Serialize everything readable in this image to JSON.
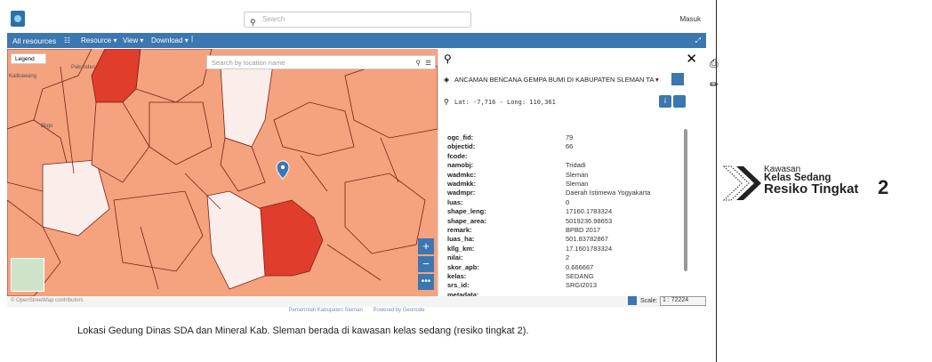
{
  "topbar": {
    "search_placeholder": "Search",
    "login": "Masuk"
  },
  "navbar": {
    "all_resources": "All resources",
    "resource": "Resource ▾",
    "view": "View ▾",
    "download": "Download ▾"
  },
  "map": {
    "legend": "Legend",
    "location_placeholder": "Search by location name",
    "labels": {
      "pakunden": "Pakunden",
      "kalibawang": "Kalibawang",
      "bligo": "Bligo"
    },
    "attribution": "© OpenStreetMap contributors",
    "colors": {
      "base": "#f5a27f",
      "high": "#e03d2c",
      "low": "#fbeeea"
    }
  },
  "panel": {
    "layer_title": "ANCAMAN BENCANA GEMPA BUMI DI KABUPATEN SLEMAN TA ▾",
    "coords": "Lat: -7,716 - Long: 110,361",
    "rows": [
      {
        "k": "ogc_fid:",
        "v": "79"
      },
      {
        "k": "objectid:",
        "v": "66"
      },
      {
        "k": "fcode:",
        "v": ""
      },
      {
        "k": "namobj:",
        "v": "Tridadi"
      },
      {
        "k": "wadmkc:",
        "v": "Sleman"
      },
      {
        "k": "wadmkk:",
        "v": "Sleman"
      },
      {
        "k": "wadmpr:",
        "v": "Daerah Istimewa Yogyakarta"
      },
      {
        "k": "luas:",
        "v": "0"
      },
      {
        "k": "shape_leng:",
        "v": "17160.1783324"
      },
      {
        "k": "shape_area:",
        "v": "5019236.98653"
      },
      {
        "k": "remark:",
        "v": "BPBD 2017"
      },
      {
        "k": "luas_ha:",
        "v": "501.83782867"
      },
      {
        "k": "kllg_km:",
        "v": "17.1601783324"
      },
      {
        "k": "nilai:",
        "v": "2"
      },
      {
        "k": "skor_apb:",
        "v": "0.666667"
      },
      {
        "k": "kelas:",
        "v": "SEDANG"
      },
      {
        "k": "srs_id:",
        "v": "SRGI2013"
      },
      {
        "k": "metadata:",
        "v": ""
      }
    ]
  },
  "footer": {
    "scale_label": "Scale:",
    "scale_value": "1 : 72224",
    "link1": "Pemerintah Kabupaten Sleman",
    "link2": "Powered by Geonode"
  },
  "caption": "Lokasi Gedung Dinas SDA dan Mineral Kab. Sleman berada di kawasan kelas sedang (resiko tingkat 2).",
  "badge": {
    "line1": "Kawasan",
    "line2": "Kelas Sedang",
    "line3": "Resiko Tingkat",
    "num": "2"
  }
}
